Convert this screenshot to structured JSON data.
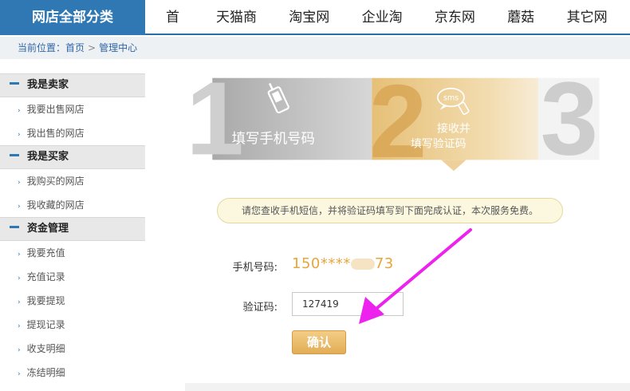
{
  "header": {
    "category_label": "网店全部分类",
    "nav": [
      "首 页",
      "天猫商城",
      "淘宝网店",
      "企业淘宝",
      "京东网店",
      "蘑菇街",
      "其它网店"
    ]
  },
  "breadcrumb": {
    "prefix": "当前位置：",
    "home": "首页",
    "separator": ">",
    "current": "管理中心"
  },
  "sidebar": {
    "sections": [
      {
        "title": "我是卖家",
        "items": [
          "我要出售网店",
          "我出售的网店"
        ]
      },
      {
        "title": "我是买家",
        "items": [
          "我购买的网店",
          "我收藏的网店"
        ]
      },
      {
        "title": "资金管理",
        "items": [
          "我要充值",
          "充值记录",
          "我要提现",
          "提现记录",
          "收支明细",
          "冻结明细"
        ]
      }
    ]
  },
  "steps": {
    "step1_number": "1",
    "step1_label": "填写手机号码",
    "step2_number": "2",
    "step2_icon_text": "sms",
    "step2_label_line1": "接收并",
    "step2_label_line2": "填写验证码",
    "step3_number": "3"
  },
  "notice": "请您查收手机短信，并将验证码填写到下面完成认证，本次服务免费。",
  "form": {
    "phone_label": "手机号码:",
    "phone_prefix": "150****",
    "phone_suffix": "73",
    "code_label": "验证码:",
    "code_value": "127419",
    "confirm_label": "确认"
  },
  "colors": {
    "brand_blue": "#2f78b4",
    "step_gold": "#e8c27a",
    "phone_orange": "#e8a53c",
    "arrow_magenta": "#ee22ee"
  }
}
